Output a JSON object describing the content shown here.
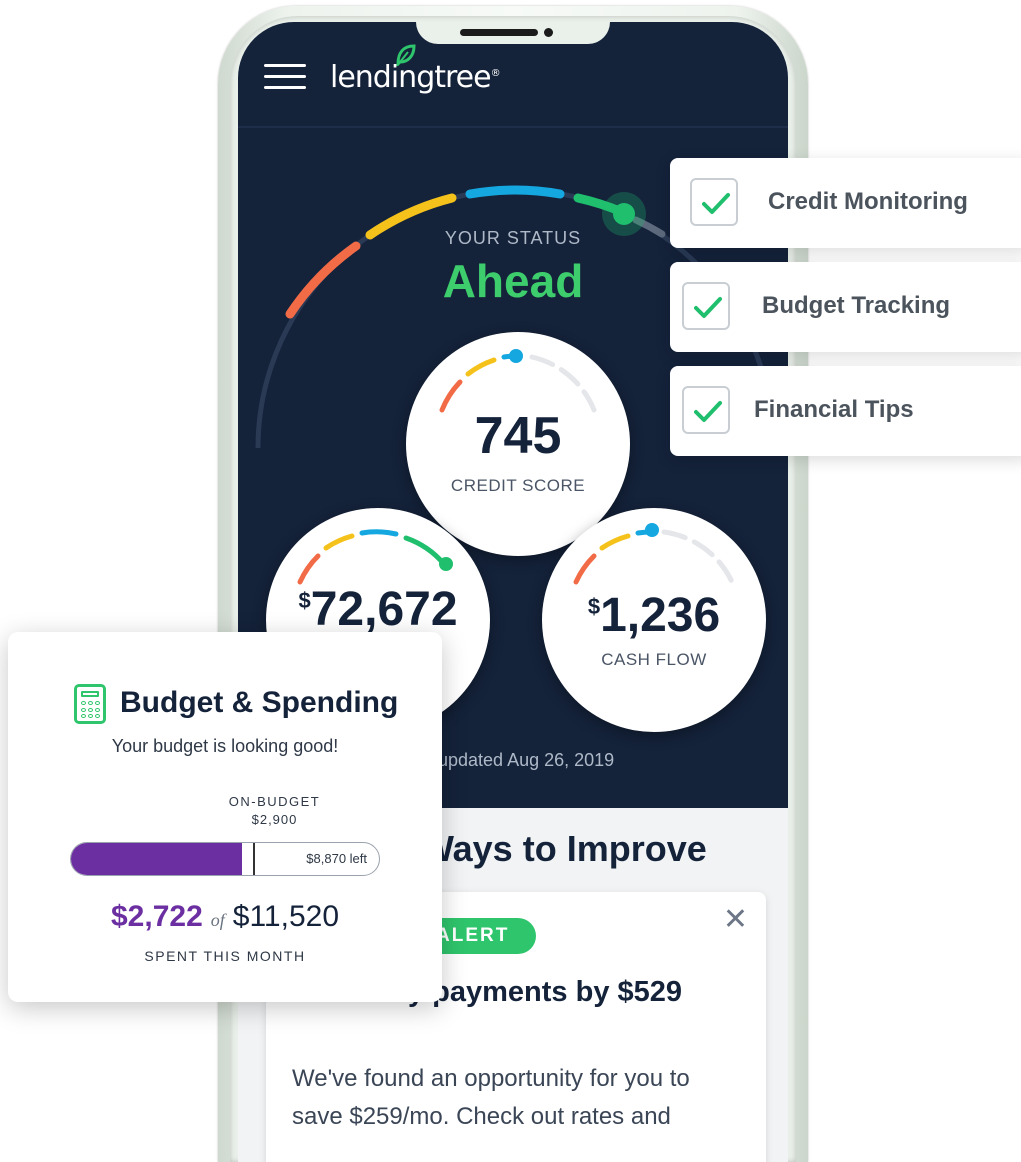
{
  "app": {
    "logo": "lendingtree",
    "logo_mark": "®"
  },
  "status": {
    "label": "YOUR STATUS",
    "value": "Ahead"
  },
  "metrics": {
    "credit_score": {
      "value": "745",
      "caption": "CREDIT SCORE"
    },
    "net_worth": {
      "currency": "$",
      "value": "72,672"
    },
    "cash_flow": {
      "currency": "$",
      "value": "1,236",
      "caption": "CASH FLOW"
    }
  },
  "updated_text": "updated Aug 26, 2019",
  "improve": {
    "title": "Ways to Improve",
    "badge": "ALERT",
    "alert_title": "r monthly payments by $529",
    "alert_body": "We've found an opportunity for you to save $259/mo. Check out rates and"
  },
  "features": [
    {
      "label": "Credit Monitoring",
      "checked": true
    },
    {
      "label": "Budget Tracking",
      "checked": true
    },
    {
      "label": "Financial Tips",
      "checked": true
    }
  ],
  "budget": {
    "title": "Budget & Spending",
    "subtitle": "Your budget is looking good!",
    "on_budget_label": "ON-BUDGET",
    "on_budget_amount": "$2,900",
    "left_text": "$8,870 left",
    "spent": "$2,722",
    "of": "of",
    "total": "$11,520",
    "caption": "SPENT THIS MONTH",
    "spent_fraction": 0.236,
    "on_budget_fraction": 0.252
  },
  "colors": {
    "navy": "#14223a",
    "green": "#3dcd6c",
    "purple": "#6b2fa2",
    "orange": "#f26b47",
    "yellow": "#f5c21b",
    "blue": "#15a7e0",
    "gauge_green": "#1fbf6e"
  },
  "icons": [
    "hamburger-icon",
    "leaf-icon",
    "close-icon",
    "check-icon",
    "calculator-icon"
  ]
}
